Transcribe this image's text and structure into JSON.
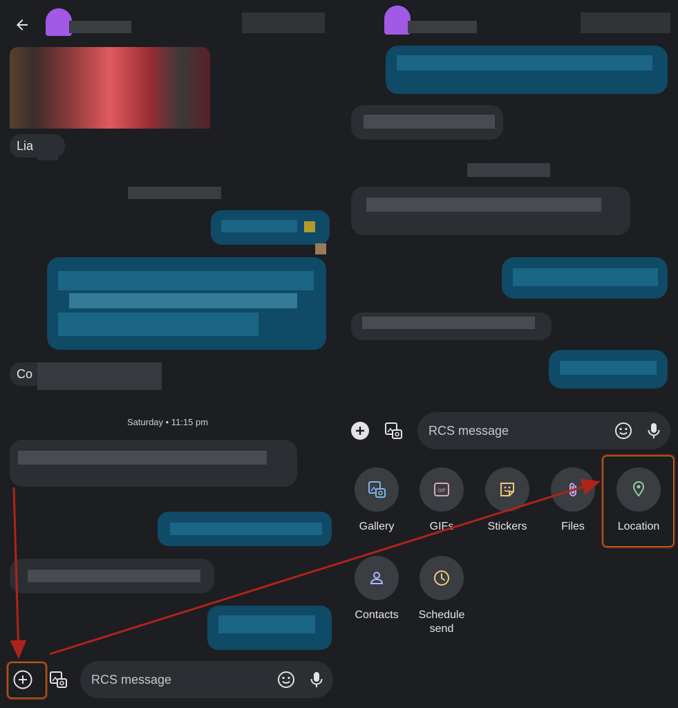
{
  "left": {
    "chip_text_1": "Lia",
    "chip_text_2": "Co",
    "timestamp": "Saturday • 11:15 pm",
    "composer_placeholder": "RCS message"
  },
  "right": {
    "composer_placeholder": "RCS message",
    "attach_options": [
      {
        "label": "Gallery",
        "icon": "gallery-icon",
        "color": "#7fb4e8"
      },
      {
        "label": "GIFs",
        "icon": "gif-icon",
        "color": "#d9a8b8"
      },
      {
        "label": "Stickers",
        "icon": "sticker-icon",
        "color": "#f0c67a"
      },
      {
        "label": "Files",
        "icon": "paperclip-icon",
        "color": "#c3a7ef"
      },
      {
        "label": "Location",
        "icon": "location-pin-icon",
        "color": "#8fd19e"
      },
      {
        "label": "Contacts",
        "icon": "contact-icon",
        "color": "#a9b8ff"
      },
      {
        "label": "Schedule\nsend",
        "icon": "clock-icon",
        "color": "#f0c67a"
      }
    ]
  },
  "colors": {
    "background": "#1c1e21",
    "bubble_outgoing": "#0f4a67",
    "bubble_incoming": "#2b2e33",
    "avatar": "#a259e6",
    "highlight": "#8a2a1e",
    "arrow": "#b0231a"
  }
}
